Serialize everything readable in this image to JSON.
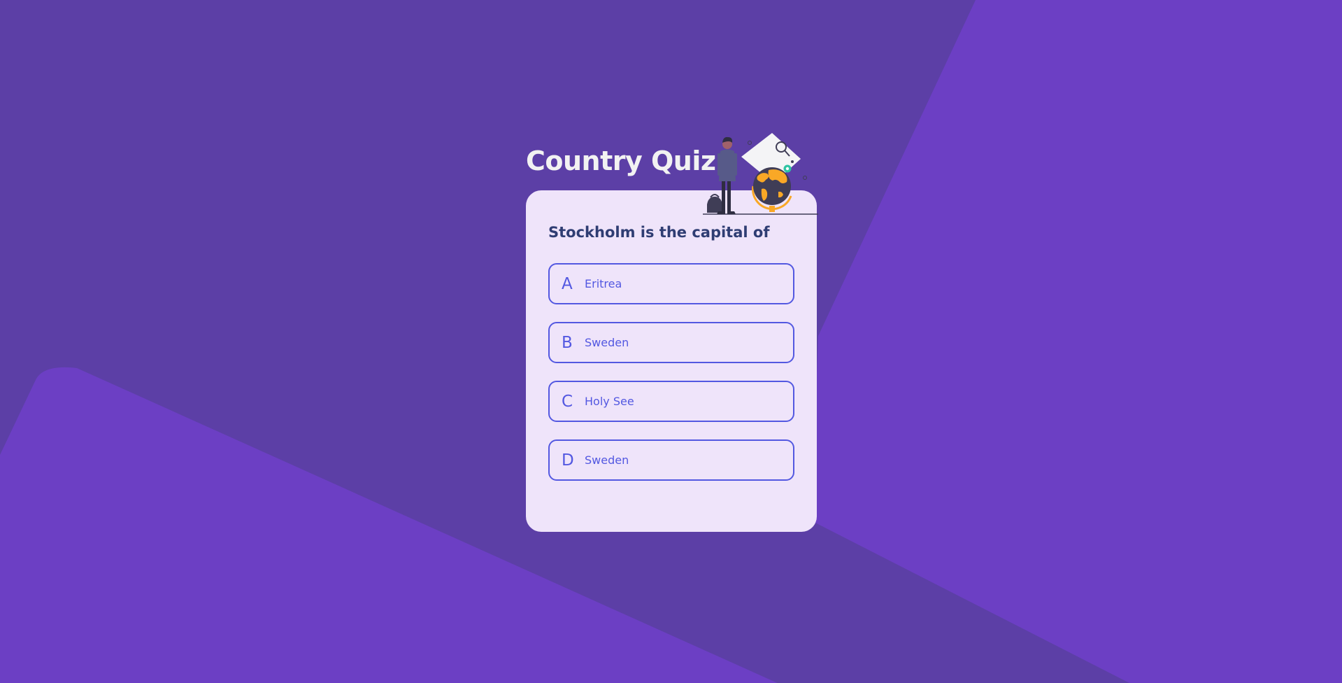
{
  "app": {
    "title": "Country Quiz"
  },
  "quiz": {
    "question": "Stockholm is the capital of",
    "options": [
      {
        "letter": "A",
        "text": "Eritrea"
      },
      {
        "letter": "B",
        "text": "Sweden"
      },
      {
        "letter": "C",
        "text": "Holy See"
      },
      {
        "letter": "D",
        "text": "Sweden"
      }
    ]
  },
  "icons": {
    "illustration": "traveler-globe-illustration"
  },
  "colors": {
    "background": "#5c3fa6",
    "background_shape": "#6c3fc4",
    "card": "#efe4fa",
    "title": "#f2f2f2",
    "question": "#2f3d73",
    "accent": "#5358e1",
    "illustration_accent": "#f9a826"
  }
}
